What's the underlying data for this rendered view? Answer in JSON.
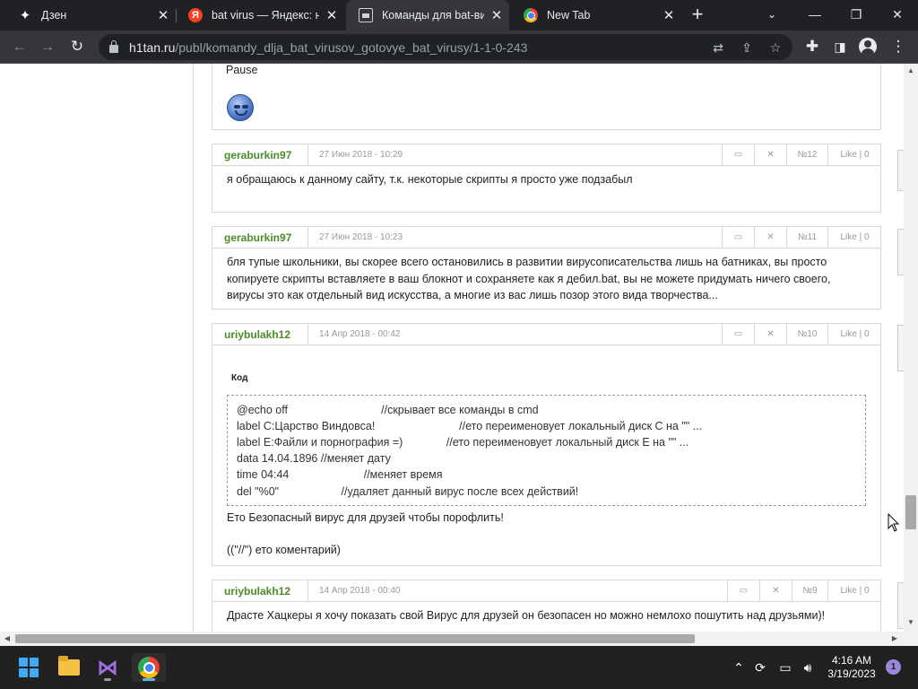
{
  "browser": {
    "tabs": [
      {
        "title": "Дзен",
        "icon": "dzen-icon"
      },
      {
        "title": "bat virus — Яндекс: на",
        "icon": "yandex-icon"
      },
      {
        "title": "Команды для bat-виру",
        "icon": "page-icon",
        "active": true
      },
      {
        "title": "New Tab",
        "icon": "chrome-icon"
      }
    ],
    "url_host": "h1tan.ru",
    "url_path": "/publ/komandy_dlja_bat_virusov_gotovye_bat_virusy/1-1-0-243"
  },
  "page": {
    "previous_tail": {
      "text": "Pause"
    },
    "comments": [
      {
        "author": "geraburkin97",
        "date": "27 Июн 2018 - 10:29",
        "number": "№12",
        "likes": "Like | 0",
        "text": "я обращаюсь к данному сайту, т.к. некоторые скрипты я просто уже подзабыл"
      },
      {
        "author": "geraburkin97",
        "date": "27 Июн 2018 - 10:23",
        "number": "№11",
        "likes": "Like | 0",
        "text": "бля тупые школьники, вы скорее всего остановились в развитии вирусописательства лишь на батниках, вы просто копируете скрипты вставляете в ваш блокнот и сохраняете как я дебил.bat, вы не можете придумать ничего своего, вирусы это как отдельный вид искусства, а многие из вас лишь позор этого вида творчества..."
      },
      {
        "author": "uriybulakh12",
        "date": "14 Апр 2018 - 00:42",
        "number": "№10",
        "likes": "Like | 0",
        "code_label": "Код",
        "code_lines": [
          "@echo off                              //скрывает все команды в cmd",
          "label C:Царство Виндовса!                           //ето переименовует локальный диск C на \"\" ...",
          "label E:Файли и порнография =)              //ето переименовует локальный диск E на \"\" ...",
          "data 14.04.1896 //меняет дату",
          "time 04:44                        //меняет время",
          "del \"%0\"                    //удаляет данный вирус после всех действий!"
        ],
        "after_code": "Ето Безопасный вирус для друзей чтобы порофлить!",
        "note": "((\"//\") ето коментарий)"
      },
      {
        "author": "uriybulakh12",
        "date": "14 Апр 2018 - 00:40",
        "number": "№9",
        "likes": "Like | 0",
        "text": "Драсте Хацкеры я хочу показать свой Вирус для друзей он безопасен но можно немлохо пошутить над друзьями)!"
      }
    ]
  },
  "taskbar": {
    "apps": [
      "start-button",
      "file-explorer",
      "visual-studio",
      "chrome"
    ],
    "time": "4:16 AM",
    "date": "3/19/2023",
    "notifications": "1"
  }
}
